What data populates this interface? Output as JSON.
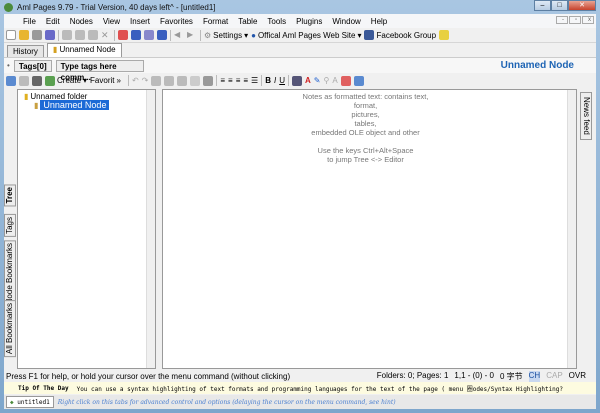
{
  "window": {
    "title": "Aml Pages 9.79 - Trial Version, 40 days left^ - [untitled1]",
    "min": "–",
    "max": "□",
    "close": "✕"
  },
  "menu": [
    "File",
    "Edit",
    "Nodes",
    "View",
    "Insert",
    "Favorites",
    "Format",
    "Table",
    "Tools",
    "Plugins",
    "Window",
    "Help"
  ],
  "toolbar": {
    "settings": "Settings",
    "website": "Offical Aml Pages Web Site",
    "facebook": "Facebook Group"
  },
  "tabs": {
    "history": "History",
    "node": "Unnamed Node"
  },
  "tags": {
    "label": "Tags[0]",
    "placeholder": "Type tags here comm...",
    "node_title": "Unnamed Node"
  },
  "tree_toolbar": {
    "create": "Create",
    "favorites": "Favorit"
  },
  "format_toolbar": {
    "bold": "B",
    "italic": "I",
    "underline": "U"
  },
  "side_tabs": [
    "Tree",
    "Tags",
    "Node Bookmarks",
    "All Bookmarks"
  ],
  "tree": {
    "folder": "Unnamed folder",
    "node": "Unnamed Node"
  },
  "editor_hint": [
    "Notes as formatted text: contains text,",
    "format,",
    "pictures,",
    "tables,",
    "embedded OLE object and other",
    "",
    "Use the keys Ctrl+Alt+Space",
    "to jump Tree <-> Editor"
  ],
  "news_tab": "News feed",
  "status": {
    "help": "Press F1 for help, or hold your cursor over the menu command (without clicking)",
    "counts": "Folders: 0; Pages: 1",
    "pos": "1,1 - (0) - 0",
    "chars": "0 字节",
    "ch": "CH",
    "cap": "CAP",
    "ovr": "OVR"
  },
  "tip": {
    "title": "Tip Of The Day",
    "text": "You can use a syntax highlighting of text formats and programming languages for the text of the page ( menu 圈odes/Syntax Highlighting?"
  },
  "bottom": {
    "tab": "untitled1",
    "hint": "Right click on this tabs for advanced control and options (delaying the cursor on the menu command, see hint)"
  }
}
